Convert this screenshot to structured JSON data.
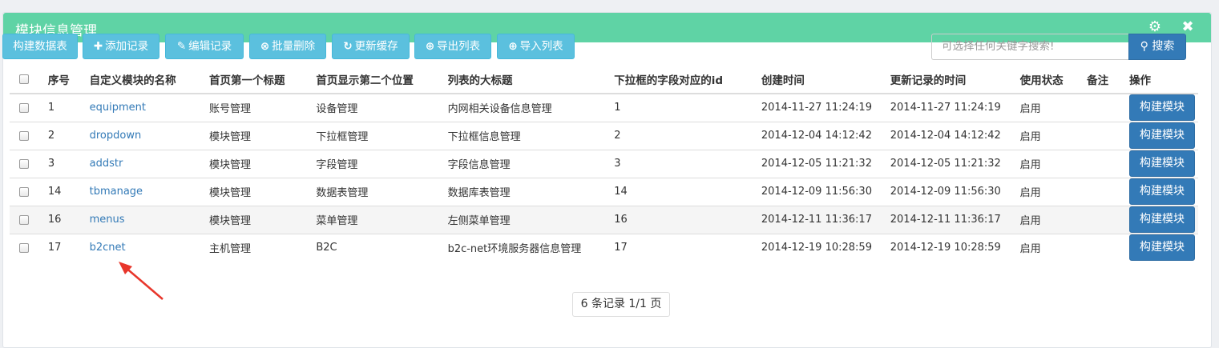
{
  "panel": {
    "title": "模块信息管理",
    "header_color": "#5fd3a5"
  },
  "toolbar": {
    "buttons": [
      {
        "label": "构建数据表",
        "icon": ""
      },
      {
        "label": "添加记录",
        "icon": "plus-icon"
      },
      {
        "label": "编辑记录",
        "icon": "edit-icon"
      },
      {
        "label": "批量删除",
        "icon": "remove-circle-icon"
      },
      {
        "label": "更新缓存",
        "icon": "refresh-icon"
      },
      {
        "label": "导出列表",
        "icon": "download-circle-icon"
      },
      {
        "label": "导入列表",
        "icon": "upload-circle-icon"
      }
    ]
  },
  "search": {
    "placeholder": "可选择任何关键字搜索!",
    "button_label": "搜索"
  },
  "table": {
    "headers": [
      "序号",
      "自定义模块的名称",
      "首页第一个标题",
      "首页显示第二个位置",
      "列表的大标题",
      "下拉框的字段对应的id",
      "创建时间",
      "更新记录的时间",
      "使用状态",
      "备注",
      "操作"
    ],
    "rows": [
      {
        "id": "1",
        "name": "equipment",
        "title1": "账号管理",
        "title2": "设备管理",
        "list_title": "内网相关设备信息管理",
        "dropdown_id": "1",
        "created": "2014-11-27 11:24:19",
        "updated": "2014-11-27 11:24:19",
        "status": "启用",
        "note": "",
        "action": "构建模块"
      },
      {
        "id": "2",
        "name": "dropdown",
        "title1": "模块管理",
        "title2": "下拉框管理",
        "list_title": "下拉框信息管理",
        "dropdown_id": "2",
        "created": "2014-12-04 14:12:42",
        "updated": "2014-12-04 14:12:42",
        "status": "启用",
        "note": "",
        "action": "构建模块"
      },
      {
        "id": "3",
        "name": "addstr",
        "title1": "模块管理",
        "title2": "字段管理",
        "list_title": "字段信息管理",
        "dropdown_id": "3",
        "created": "2014-12-05 11:21:32",
        "updated": "2014-12-05 11:21:32",
        "status": "启用",
        "note": "",
        "action": "构建模块"
      },
      {
        "id": "14",
        "name": "tbmanage",
        "title1": "模块管理",
        "title2": "数据表管理",
        "list_title": "数据库表管理",
        "dropdown_id": "14",
        "created": "2014-12-09 11:56:30",
        "updated": "2014-12-09 11:56:30",
        "status": "启用",
        "note": "",
        "action": "构建模块"
      },
      {
        "id": "16",
        "name": "menus",
        "title1": "模块管理",
        "title2": "菜单管理",
        "list_title": "左侧菜单管理",
        "dropdown_id": "16",
        "created": "2014-12-11 11:36:17",
        "updated": "2014-12-11 11:36:17",
        "status": "启用",
        "note": "",
        "action": "构建模块"
      },
      {
        "id": "17",
        "name": "b2cnet",
        "title1": "主机管理",
        "title2": "B2C",
        "list_title": "b2c-net环境服务器信息管理",
        "dropdown_id": "17",
        "created": "2014-12-19 10:28:59",
        "updated": "2014-12-19 10:28:59",
        "status": "启用",
        "note": "",
        "action": "构建模块"
      }
    ]
  },
  "pager": {
    "text": "6 条记录 1/1 页"
  },
  "annotation": {
    "color": "#e8362b"
  }
}
